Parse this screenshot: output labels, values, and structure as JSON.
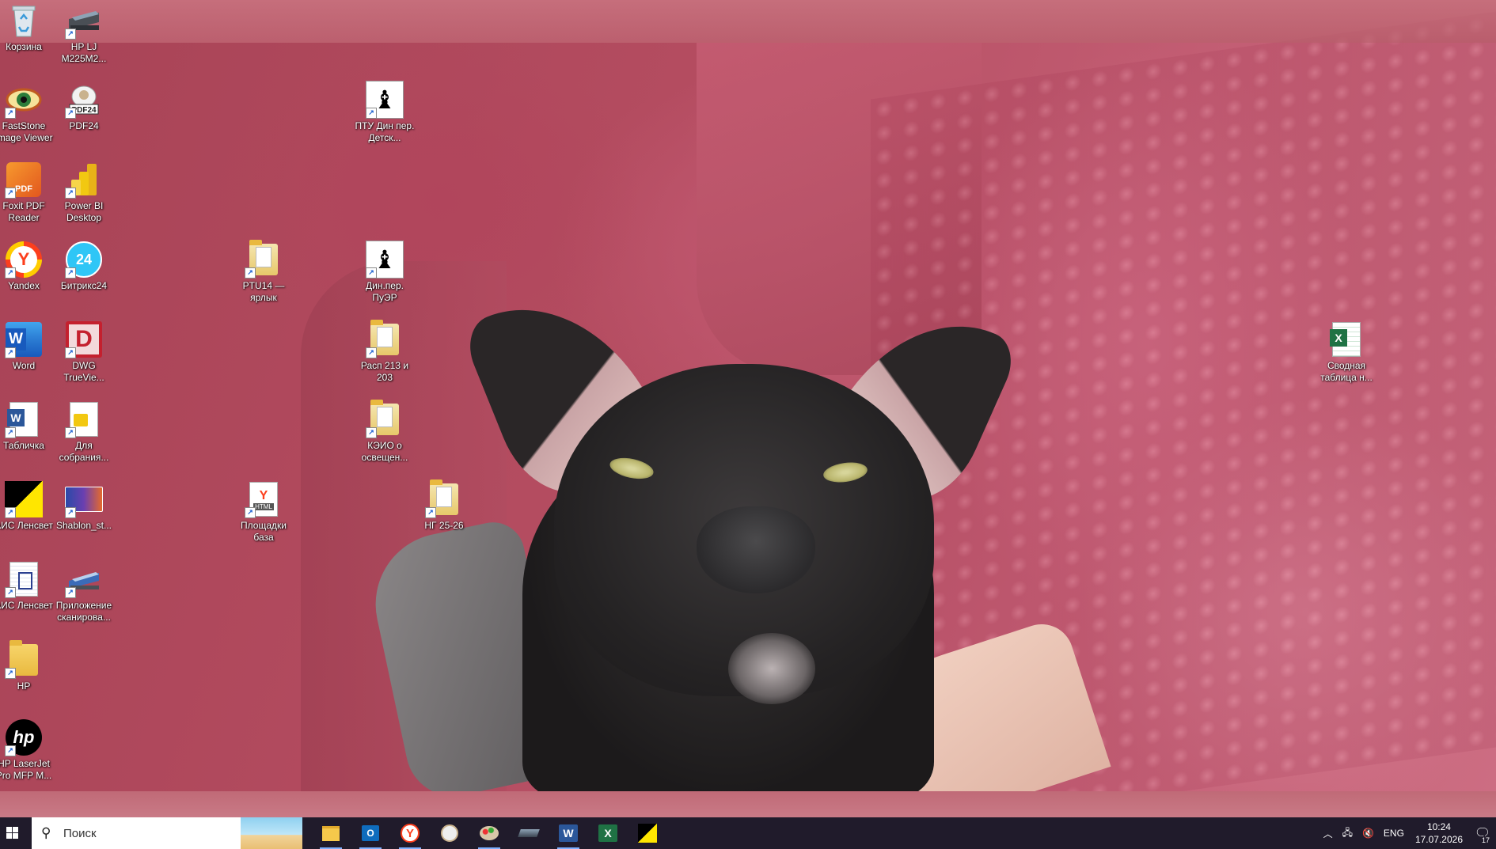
{
  "desktop_icons": [
    {
      "label": "Корзина"
    },
    {
      "label": "HP LJ M225M2..."
    },
    {
      "label": "FastStone Image Viewer"
    },
    {
      "label": "PDF24"
    },
    {
      "label": "Foxit PDF Reader"
    },
    {
      "label": "Power BI Desktop"
    },
    {
      "label": "Yandex"
    },
    {
      "label": "Битрикс24"
    },
    {
      "label": "Word"
    },
    {
      "label": "DWG TrueVie..."
    },
    {
      "label": "Табличка"
    },
    {
      "label": "Для собрания..."
    },
    {
      "label": "АИС Ленсвет"
    },
    {
      "label": "Shablon_st..."
    },
    {
      "label": "АИС Ленсвет"
    },
    {
      "label": "Приложение сканирова..."
    },
    {
      "label": "HP"
    },
    {
      "label": "HP LaserJet Pro MFP M..."
    },
    {
      "label": "PTU14 — ярлык"
    },
    {
      "label": "Площадки база"
    },
    {
      "label": "ПТУ Дин пер. Детск..."
    },
    {
      "label": "Дин.пер. ПуЭР"
    },
    {
      "label": "Расп 213 и 203"
    },
    {
      "label": "КЭИО о освещен..."
    },
    {
      "label": "НГ 25-26"
    },
    {
      "label": "Сводная таблица н..."
    }
  ],
  "taskbar": {
    "search_placeholder": "Поиск",
    "tray_lang": "ENG",
    "time": "10:24",
    "date": "17.07.2026",
    "notification_badge": "17"
  },
  "icons_semantic": {
    "word_letter": "W",
    "excel_letter": "X",
    "yandex_letter": "Y",
    "bitrix_text": "24",
    "pdf_text": "PDF",
    "dwg_letter": "D",
    "hp_text": "hp",
    "html_text": "HTML"
  },
  "colors": {
    "taskbar_bg": "#201b2b",
    "word_blue": "#2b579a",
    "excel_green": "#1f7244",
    "yandex_red": "#fc3f1d"
  }
}
